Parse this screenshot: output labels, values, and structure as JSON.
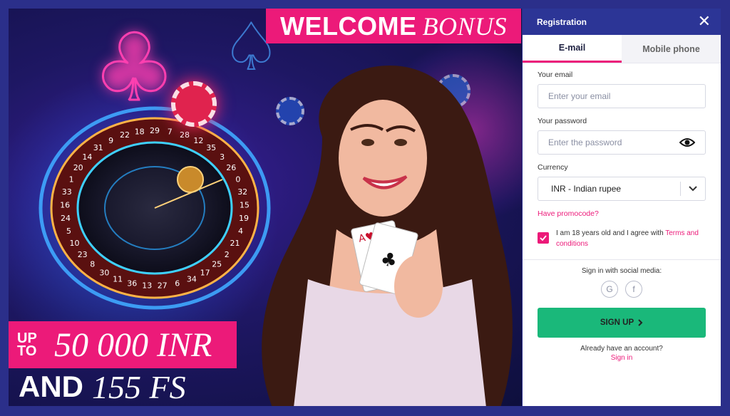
{
  "promo": {
    "welcome_word": "WELCOME",
    "bonus_word": "BONUS",
    "up_to": "UP TO",
    "amount": "50 000 INR",
    "and_word": "AND",
    "free_spins": "155 FS",
    "roulette_numbers": [
      "29",
      "7",
      "28",
      "12",
      "35",
      "3",
      "26",
      "0",
      "32",
      "15",
      "19",
      "4",
      "21",
      "2",
      "25",
      "17",
      "34",
      "6",
      "27",
      "13",
      "36",
      "11",
      "30",
      "8",
      "23",
      "10",
      "5",
      "24",
      "16",
      "33",
      "1",
      "20",
      "14",
      "31",
      "9",
      "22",
      "18"
    ]
  },
  "registration": {
    "title": "Registration",
    "close_glyph": "✕",
    "tabs": [
      {
        "label": "E-mail",
        "active": true
      },
      {
        "label": "Mobile phone",
        "active": false
      }
    ],
    "email": {
      "label": "Your email",
      "placeholder": "Enter your email"
    },
    "password": {
      "label": "Enter the password",
      "field_label": "Your password"
    },
    "currency": {
      "label": "Currency",
      "value": "INR - Indian rupee"
    },
    "promocode_link": "Have promocode?",
    "agree": {
      "text": "I am 18 years old and I agree with ",
      "link": "Terms and conditions",
      "checked": true
    },
    "social": {
      "title": "Sign in with social media:",
      "google": "G",
      "facebook": "f"
    },
    "signup_label": "SIGN UP",
    "already_text": "Already have an account?",
    "signin_link": "Sign in"
  },
  "colors": {
    "accent": "#ec1a79",
    "header": "#2c3596",
    "signup": "#1ab87a"
  }
}
